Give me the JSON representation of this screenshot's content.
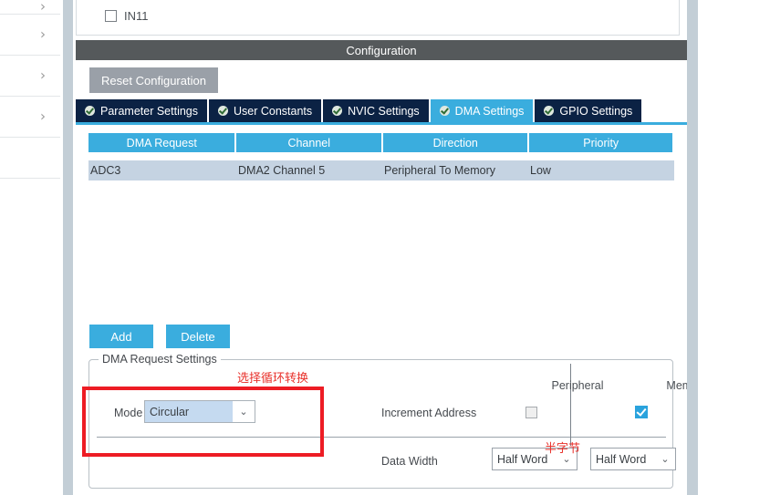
{
  "sidebar": {
    "items": [
      {
        "icon": "chevron-right-icon"
      },
      {
        "icon": "chevron-right-icon"
      },
      {
        "icon": "chevron-right-icon"
      },
      {
        "icon": "chevron-right-icon"
      },
      {
        "icon": "chevron-right-icon"
      }
    ],
    "chevron_glyph": "›"
  },
  "top_panel": {
    "checkbox_label": "IN11",
    "checked": false
  },
  "config": {
    "header_title": "Configuration",
    "reset_label": "Reset Configuration"
  },
  "tabs": [
    {
      "label": "Parameter Settings",
      "icon": "check-circle-icon",
      "active": false
    },
    {
      "label": "User Constants",
      "icon": "check-circle-icon",
      "active": false
    },
    {
      "label": "NVIC Settings",
      "icon": "check-circle-icon",
      "active": false
    },
    {
      "label": "DMA Settings",
      "icon": "check-circle-icon",
      "active": true
    },
    {
      "label": "GPIO Settings",
      "icon": "check-circle-icon",
      "active": false
    }
  ],
  "table": {
    "columns": [
      "DMA Request",
      "Channel",
      "Direction",
      "Priority"
    ],
    "rows": [
      {
        "request": "ADC3",
        "channel": "DMA2 Channel 5",
        "direction": "Peripheral To Memory",
        "priority": "Low"
      }
    ]
  },
  "actions": {
    "add_label": "Add",
    "delete_label": "Delete"
  },
  "request_settings": {
    "legend": "DMA Request Settings",
    "column_headers": {
      "peripheral": "Peripheral",
      "memory": "Memory"
    },
    "mode": {
      "label": "Mode",
      "value": "Circular",
      "arrow_glyph": "⌄"
    },
    "increment_address": {
      "label": "Increment Address",
      "peripheral_checked": false,
      "memory_checked": true
    },
    "data_width": {
      "label": "Data Width",
      "peripheral_value": "Half Word",
      "memory_value": "Half Word",
      "arrow_glyph": "⌄"
    }
  },
  "annotations": [
    {
      "text": "选择循环转换",
      "color": "#ed1c24"
    },
    {
      "text": "半字节",
      "color": "#ed1c24"
    }
  ],
  "colors": {
    "accent_blue": "#3aadde",
    "tab_navy": "#0b2244",
    "header_gray": "#55595b",
    "row_blue": "#c5d3e2",
    "annotation_red": "#ed1c24"
  }
}
